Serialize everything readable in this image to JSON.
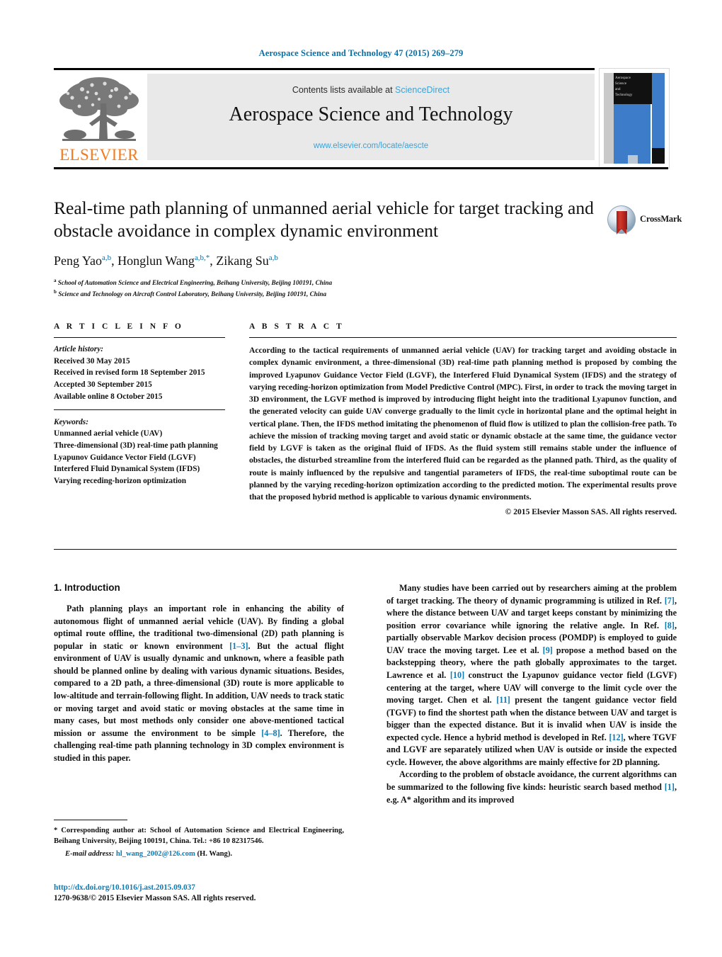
{
  "running_head": "Aerospace Science and Technology 47 (2015) 269–279",
  "masthead": {
    "contents_prefix": "Contents lists available at ",
    "sciencedirect": "ScienceDirect",
    "journal_title": "Aerospace Science and Technology",
    "journal_url": "www.elsevier.com/locate/aescte",
    "publisher_logo_text": "ELSEVIER",
    "cover_title_lines": [
      "Aerospace",
      "Science",
      "and",
      "Technology"
    ]
  },
  "article": {
    "title": "Real-time path planning of unmanned aerial vehicle for target tracking and obstacle avoidance in complex dynamic environment",
    "authors": [
      {
        "name": "Peng Yao",
        "marks": "a,b",
        "corresponding": false
      },
      {
        "name": "Honglun Wang",
        "marks": "a,b,",
        "corresponding": true
      },
      {
        "name": "Zikang Su",
        "marks": "a,b",
        "corresponding": false
      }
    ],
    "affiliations": [
      {
        "mark": "a",
        "text": "School of Automation Science and Electrical Engineering, Beihang University, Beijing 100191, China"
      },
      {
        "mark": "b",
        "text": "Science and Technology on Aircraft Control Laboratory, Beihang University, Beijing 100191, China"
      }
    ],
    "crossmark_label": "CrossMark"
  },
  "info": {
    "heading": "A R T I C L E   I N F O",
    "history_label": "Article history:",
    "history": [
      "Received 30 May 2015",
      "Received in revised form 18 September 2015",
      "Accepted 30 September 2015",
      "Available online 8 October 2015"
    ],
    "keywords_label": "Keywords:",
    "keywords": [
      "Unmanned aerial vehicle (UAV)",
      "Three-dimensional (3D) real-time path planning",
      "Lyapunov Guidance Vector Field (LGVF)",
      "Interfered Fluid Dynamical System (IFDS)",
      "Varying receding-horizon optimization"
    ]
  },
  "abstract": {
    "heading": "A B S T R A C T",
    "text": "According to the tactical requirements of unmanned aerial vehicle (UAV) for tracking target and avoiding obstacle in complex dynamic environment, a three-dimensional (3D) real-time path planning method is proposed by combing the improved Lyapunov Guidance Vector Field (LGVF), the Interfered Fluid Dynamical System (IFDS) and the strategy of varying receding-horizon optimization from Model Predictive Control (MPC). First, in order to track the moving target in 3D environment, the LGVF method is improved by introducing flight height into the traditional Lyapunov function, and the generated velocity can guide UAV converge gradually to the limit cycle in horizontal plane and the optimal height in vertical plane. Then, the IFDS method imitating the phenomenon of fluid flow is utilized to plan the collision-free path. To achieve the mission of tracking moving target and avoid static or dynamic obstacle at the same time, the guidance vector field by LGVF is taken as the original fluid of IFDS. As the fluid system still remains stable under the influence of obstacles, the disturbed streamline from the interfered fluid can be regarded as the planned path. Third, as the quality of route is mainly influenced by the repulsive and tangential parameters of IFDS, the real-time suboptimal route can be planned by the varying receding-horizon optimization according to the predicted motion. The experimental results prove that the proposed hybrid method is applicable to various dynamic environments.",
    "copyright": "© 2015 Elsevier Masson SAS. All rights reserved."
  },
  "body": {
    "section_title": "1. Introduction",
    "left_paragraphs": [
      "Path planning plays an important role in enhancing the ability of autonomous flight of unmanned aerial vehicle (UAV). By finding a global optimal route offline, the traditional two-dimensional (2D) path planning is popular in static or known environment [1–3]. But the actual flight environment of UAV is usually dynamic and unknown, where a feasible path should be planned online by dealing with various dynamic situations. Besides, compared to a 2D path, a three-dimensional (3D) route is more applicable to low-altitude and terrain-following flight. In addition, UAV needs to track static or moving target and avoid static or moving obstacles at the same time in many cases, but most methods only consider one above-mentioned tactical mission or assume the environment to be simple [4–8]. Therefore, the challenging real-time path planning technology in 3D complex environment is studied in this paper."
    ],
    "right_paragraphs": [
      "Many studies have been carried out by researchers aiming at the problem of target tracking. The theory of dynamic programming is utilized in Ref. [7], where the distance between UAV and target keeps constant by minimizing the position error covariance while ignoring the relative angle. In Ref. [8], partially observable Markov decision process (POMDP) is employed to guide UAV trace the moving target. Lee et al. [9] propose a method based on the backstepping theory, where the path globally approximates to the target. Lawrence et al. [10] construct the Lyapunov guidance vector field (LGVF) centering at the target, where UAV will converge to the limit cycle over the moving target. Chen et al. [11] present the tangent guidance vector field (TGVF) to find the shortest path when the distance between UAV and target is bigger than the expected distance. But it is invalid when UAV is inside the expected cycle. Hence a hybrid method is developed in Ref. [12], where TGVF and LGVF are separately utilized when UAV is outside or inside the expected cycle. However, the above algorithms are mainly effective for 2D planning.",
      "According to the problem of obstacle avoidance, the current algorithms can be summarized to the following five kinds: heuristic search based method [1], e.g. A* algorithm and its improved"
    ]
  },
  "footnote": {
    "corresponding_text": "* Corresponding author at: School of Automation Science and Electrical Engineering, Beihang University, Beijing 100191, China. Tel.: +86 10 82317546.",
    "email_label": "E-mail address:",
    "email": "hl_wang_2002@126.com",
    "email_suffix": "(H. Wang)."
  },
  "doi_block": {
    "doi_url": "http://dx.doi.org/10.1016/j.ast.2015.09.037",
    "issn_line": "1270-9638/© 2015 Elsevier Masson SAS. All rights reserved."
  },
  "colors": {
    "link_blue": "#0b7bb5",
    "header_blue": "#0b6fa4",
    "sciencedirect_blue": "#3ea2d6",
    "elsevier_orange": "#f47c20",
    "cover_blue": "#3d7cc9",
    "crossmark_red": "#b5261d"
  }
}
